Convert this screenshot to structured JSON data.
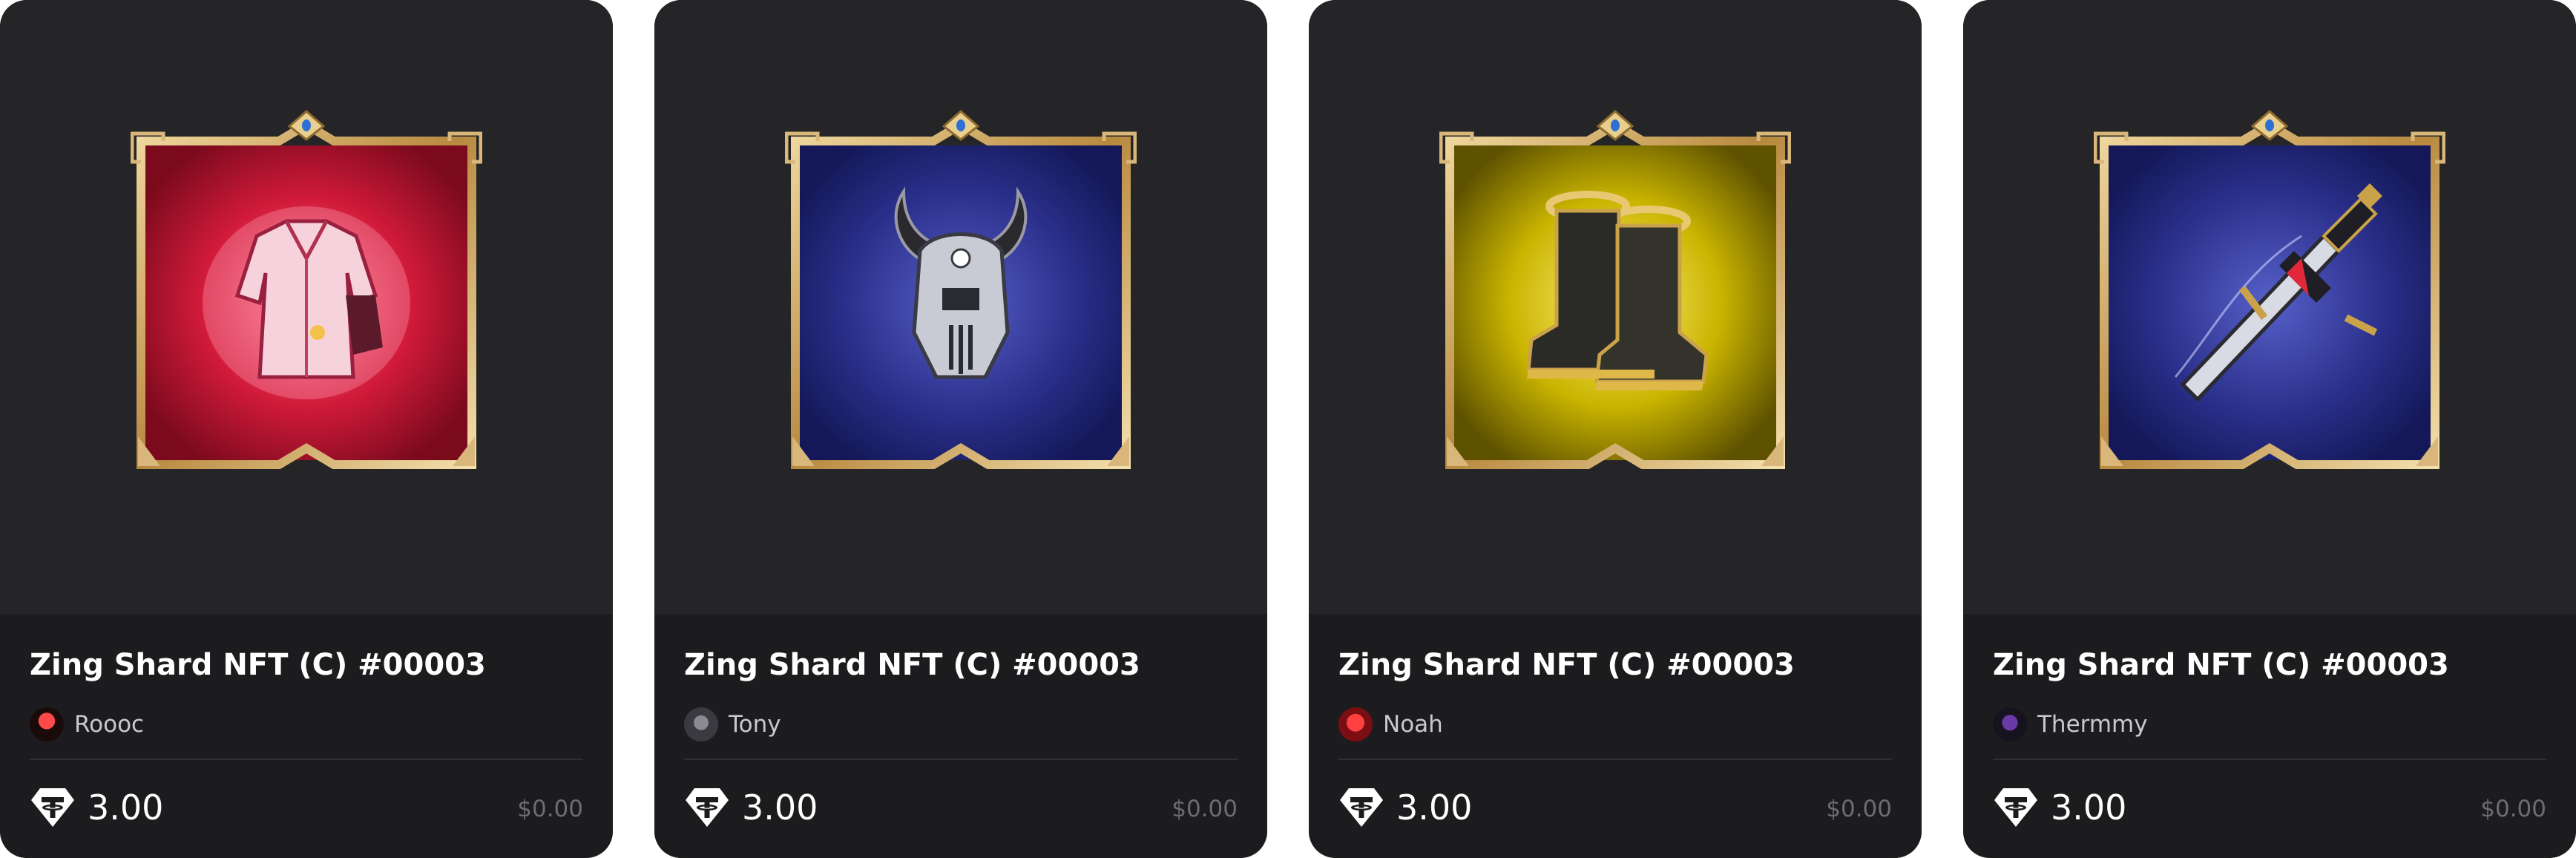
{
  "cards": [
    {
      "title": "Zing Shard NFT (C) #00003",
      "owner": "Roooc",
      "price": "3.00",
      "usd": "$0.00",
      "item": "robe-icon",
      "background": "#c8152c",
      "avatar_color": "#d2202c"
    },
    {
      "title": "Zing Shard NFT (C) #00003",
      "owner": "Tony",
      "price": "3.00",
      "usd": "$0.00",
      "item": "horned-helmet-icon",
      "background": "#2a2f8a",
      "avatar_color": "#5a5a60"
    },
    {
      "title": "Zing Shard NFT (C) #00003",
      "owner": "Noah",
      "price": "3.00",
      "usd": "$0.00",
      "item": "boots-icon",
      "background": "#c9b400",
      "avatar_color": "#d1222a"
    },
    {
      "title": "Zing Shard NFT (C) #00003",
      "owner": "Thermmy",
      "price": "3.00",
      "usd": "$0.00",
      "item": "sword-icon",
      "background": "#2a2f8a",
      "avatar_color": "#4a2c7a"
    }
  ],
  "colors": {
    "card_top": "#252527",
    "card_bottom": "#1c1c1e",
    "frame_gold": "#c9a25a",
    "gem_blue": "#2e6fd6"
  }
}
